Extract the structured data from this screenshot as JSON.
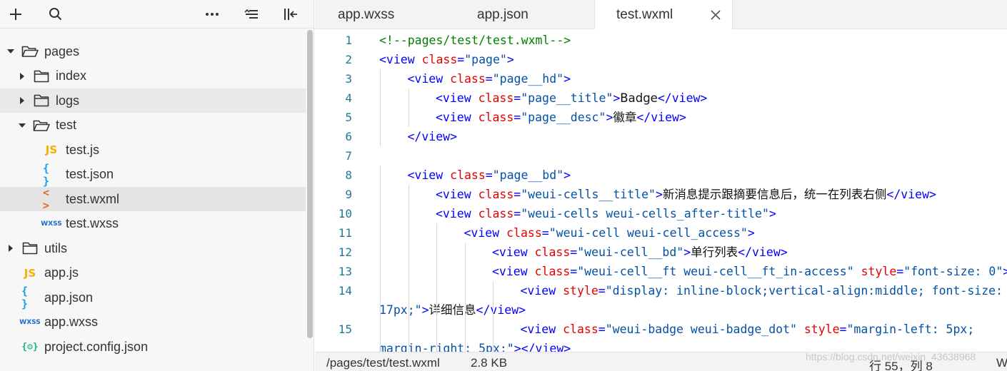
{
  "toolbar": {
    "add_icon": "plus-icon",
    "search_icon": "search-icon",
    "more_icon": "more-icon",
    "collapse_icon": "collapse-all-icon",
    "layout_icon": "toggle-sidebar-icon"
  },
  "tree": {
    "items": [
      {
        "label": "pages",
        "type": "folder",
        "expanded": true,
        "depth": 0
      },
      {
        "label": "index",
        "type": "folder",
        "expanded": false,
        "depth": 1
      },
      {
        "label": "logs",
        "type": "folder",
        "expanded": false,
        "depth": 1,
        "state": "hover"
      },
      {
        "label": "test",
        "type": "folder",
        "expanded": true,
        "depth": 1
      },
      {
        "label": "test.js",
        "type": "js",
        "icon_text": "JS",
        "depth": 2
      },
      {
        "label": "test.json",
        "type": "json",
        "icon_text": "{ }",
        "depth": 2
      },
      {
        "label": "test.wxml",
        "type": "wxml",
        "icon_text": "< >",
        "depth": 2,
        "state": "selected"
      },
      {
        "label": "test.wxss",
        "type": "wxss",
        "icon_text": "WXSS",
        "depth": 2
      },
      {
        "label": "utils",
        "type": "folder",
        "expanded": false,
        "depth": 0
      },
      {
        "label": "app.js",
        "type": "js",
        "icon_text": "JS",
        "depth": 0
      },
      {
        "label": "app.json",
        "type": "json",
        "icon_text": "{ }",
        "depth": 0
      },
      {
        "label": "app.wxss",
        "type": "wxss",
        "icon_text": "WXSS",
        "depth": 0
      },
      {
        "label": "project.config.json",
        "type": "config",
        "icon_text": "{⚙}",
        "depth": 0
      }
    ]
  },
  "tabs": [
    {
      "label": "app.wxss",
      "active": false
    },
    {
      "label": "app.json",
      "active": false
    },
    {
      "label": "test.wxml",
      "active": true
    }
  ],
  "editor": {
    "lines": [
      {
        "num": "1",
        "indent": 0,
        "tokens": [
          [
            "c",
            "<!--pages/test/test.wxml-->"
          ]
        ]
      },
      {
        "num": "2",
        "indent": 0,
        "tokens": [
          [
            "t",
            "<view "
          ],
          [
            "a",
            "class"
          ],
          [
            "p",
            "="
          ],
          [
            "v",
            "\"page\""
          ],
          [
            "t",
            ">"
          ]
        ]
      },
      {
        "num": "3",
        "indent": 1,
        "tokens": [
          [
            "t",
            "<view "
          ],
          [
            "a",
            "class"
          ],
          [
            "p",
            "="
          ],
          [
            "v",
            "\"page__hd\""
          ],
          [
            "t",
            ">"
          ]
        ]
      },
      {
        "num": "4",
        "indent": 2,
        "tokens": [
          [
            "t",
            "<view "
          ],
          [
            "a",
            "class"
          ],
          [
            "p",
            "="
          ],
          [
            "v",
            "\"page__title\""
          ],
          [
            "t",
            ">"
          ],
          [
            "x",
            "Badge"
          ],
          [
            "t",
            "</view>"
          ]
        ]
      },
      {
        "num": "5",
        "indent": 2,
        "tokens": [
          [
            "t",
            "<view "
          ],
          [
            "a",
            "class"
          ],
          [
            "p",
            "="
          ],
          [
            "v",
            "\"page__desc\""
          ],
          [
            "t",
            ">"
          ],
          [
            "x",
            "徽章"
          ],
          [
            "t",
            "</view>"
          ]
        ]
      },
      {
        "num": "6",
        "indent": 1,
        "tokens": [
          [
            "t",
            "</view>"
          ]
        ]
      },
      {
        "num": "7",
        "indent": 0,
        "tokens": []
      },
      {
        "num": "8",
        "indent": 1,
        "tokens": [
          [
            "t",
            "<view "
          ],
          [
            "a",
            "class"
          ],
          [
            "p",
            "="
          ],
          [
            "v",
            "\"page__bd\""
          ],
          [
            "t",
            ">"
          ]
        ]
      },
      {
        "num": "9",
        "indent": 2,
        "tokens": [
          [
            "t",
            "<view "
          ],
          [
            "a",
            "class"
          ],
          [
            "p",
            "="
          ],
          [
            "v",
            "\"weui-cells__title\""
          ],
          [
            "t",
            ">"
          ],
          [
            "x",
            "新消息提示跟摘要信息后，统一在列表右侧"
          ],
          [
            "t",
            "</view>"
          ]
        ]
      },
      {
        "num": "10",
        "indent": 2,
        "tokens": [
          [
            "t",
            "<view "
          ],
          [
            "a",
            "class"
          ],
          [
            "p",
            "="
          ],
          [
            "v",
            "\"weui-cells weui-cells_after-title\""
          ],
          [
            "t",
            ">"
          ]
        ]
      },
      {
        "num": "11",
        "indent": 3,
        "tokens": [
          [
            "t",
            "<view "
          ],
          [
            "a",
            "class"
          ],
          [
            "p",
            "="
          ],
          [
            "v",
            "\"weui-cell weui-cell_access\""
          ],
          [
            "t",
            ">"
          ]
        ]
      },
      {
        "num": "12",
        "indent": 4,
        "tokens": [
          [
            "t",
            "<view "
          ],
          [
            "a",
            "class"
          ],
          [
            "p",
            "="
          ],
          [
            "v",
            "\"weui-cell__bd\""
          ],
          [
            "t",
            ">"
          ],
          [
            "x",
            "单行列表"
          ],
          [
            "t",
            "</view>"
          ]
        ]
      },
      {
        "num": "13",
        "indent": 4,
        "tokens": [
          [
            "t",
            "<view "
          ],
          [
            "a",
            "class"
          ],
          [
            "p",
            "="
          ],
          [
            "v",
            "\"weui-cell__ft weui-cell__ft_in-access\""
          ],
          [
            "t",
            " "
          ],
          [
            "a",
            "style"
          ],
          [
            "p",
            "="
          ],
          [
            "v",
            "\"font-size: 0\""
          ],
          [
            "t",
            ">"
          ]
        ]
      },
      {
        "num": "14",
        "indent": 5,
        "tokens": [
          [
            "t",
            "<view "
          ],
          [
            "a",
            "style"
          ],
          [
            "p",
            "="
          ],
          [
            "v",
            "\"display: inline-block;vertical-align:middle; font-size:"
          ]
        ]
      },
      {
        "num": "",
        "indent": 0,
        "wrap": true,
        "tokens": [
          [
            "v",
            "17px;\""
          ],
          [
            "t",
            ">"
          ],
          [
            "x",
            "详细信息"
          ],
          [
            "t",
            "</view>"
          ]
        ]
      },
      {
        "num": "15",
        "indent": 5,
        "tokens": [
          [
            "t",
            "<view "
          ],
          [
            "a",
            "class"
          ],
          [
            "p",
            "="
          ],
          [
            "v",
            "\"weui-badge weui-badge_dot\""
          ],
          [
            "t",
            " "
          ],
          [
            "a",
            "style"
          ],
          [
            "p",
            "="
          ],
          [
            "v",
            "\"margin-left: 5px;"
          ]
        ]
      },
      {
        "num": "",
        "indent": 0,
        "wrap": true,
        "tokens": [
          [
            "v",
            "margin-right: 5px;\""
          ],
          [
            "t",
            "></view>"
          ]
        ]
      }
    ]
  },
  "status": {
    "path": "/pages/test/test.wxml",
    "size": "2.8 KB",
    "position": "行 55，列 8",
    "trailing": "W"
  },
  "watermark": "https://blog.csdn.net/weixin_43638968"
}
